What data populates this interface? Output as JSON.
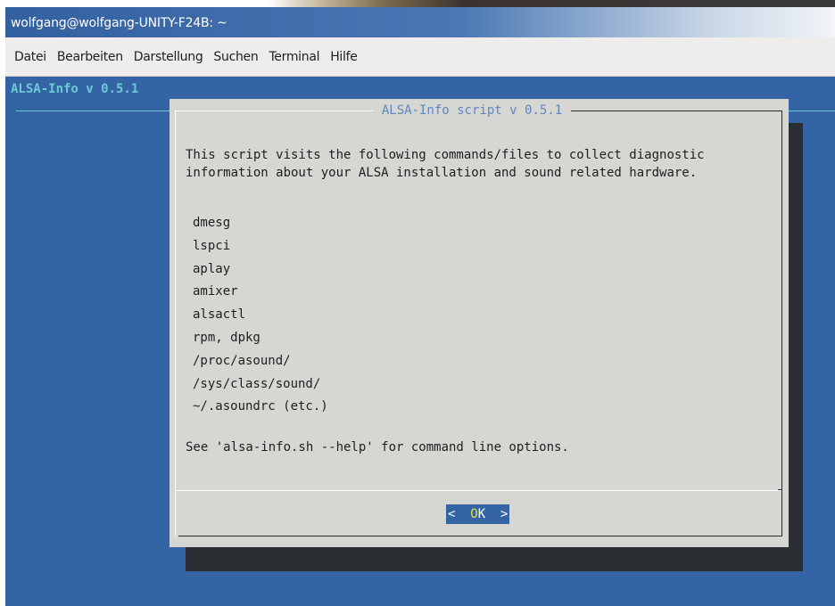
{
  "window": {
    "title": "wolfgang@wolfgang-UNITY-F24B: ~"
  },
  "menubar": {
    "items": [
      "Datei",
      "Bearbeiten",
      "Darstellung",
      "Suchen",
      "Terminal",
      "Hilfe"
    ]
  },
  "terminal": {
    "header": "ALSA-Info v 0.5.1"
  },
  "dialog": {
    "title": "ALSA-Info script v 0.5.1",
    "intro": "This script visits the following commands/files to collect diagnostic\ninformation about your ALSA installation and sound related hardware.",
    "commands": [
      "dmesg",
      "lspci",
      "aplay",
      "amixer",
      "alsactl",
      "rpm, dpkg",
      "/proc/asound/",
      "/sys/class/sound/",
      "~/.asoundrc (etc.)"
    ],
    "footer": "See 'alsa-info.sh --help' for command line options.",
    "ok_button": {
      "left": "<  ",
      "hotkey": "O",
      "rest": "K",
      "right": "  >"
    }
  },
  "colors": {
    "terminal_background": "#3464a4",
    "dialog_background": "#d6d6d2",
    "header_text": "#6ec9d6",
    "dialog_title_text": "#5e86c0",
    "hotkey": "#f0e030"
  }
}
